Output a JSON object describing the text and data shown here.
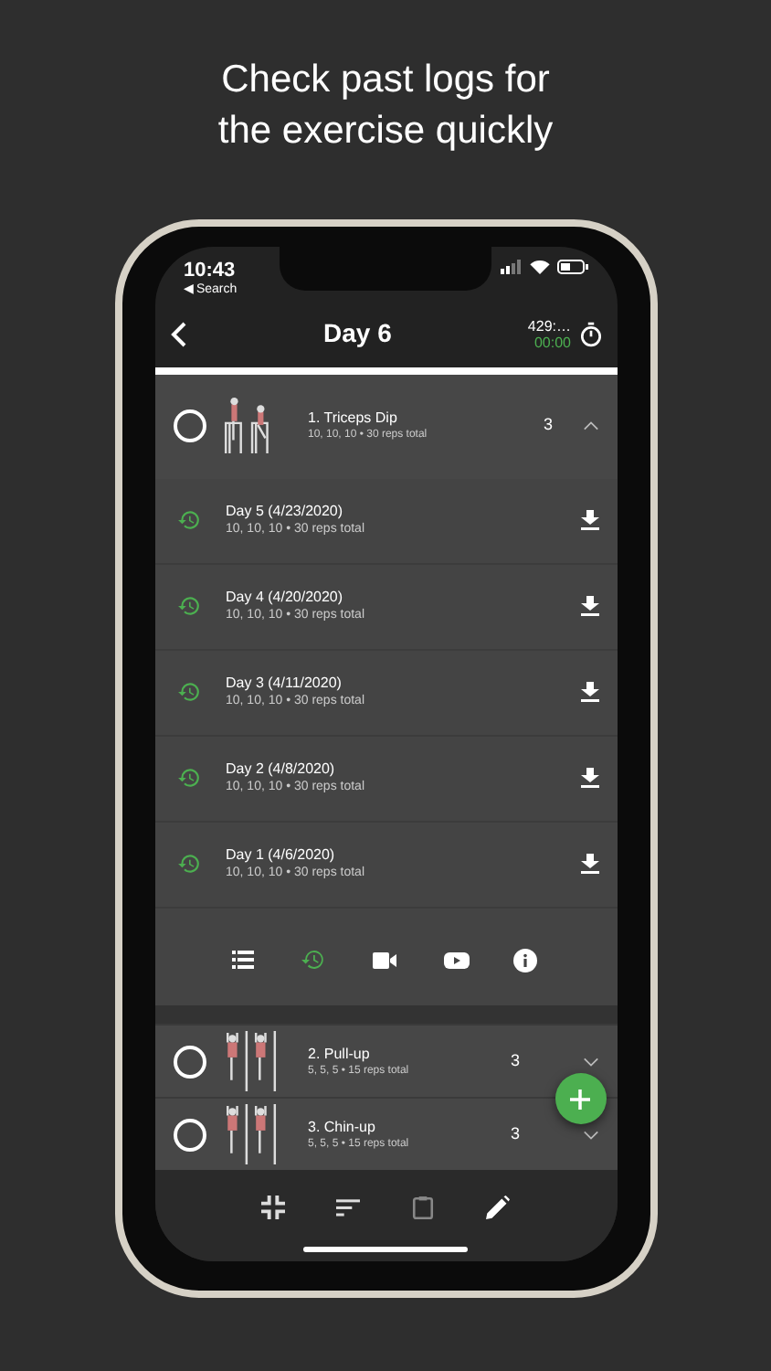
{
  "headline": [
    "Check past logs for",
    "the exercise quickly"
  ],
  "status_bar": {
    "time": "10:43",
    "back_app": "◀ Search"
  },
  "header": {
    "title": "Day 6",
    "timer_top": "429:…",
    "timer_bottom": "00:00"
  },
  "exercises": [
    {
      "name": "1. Triceps Dip",
      "summary": "10, 10, 10 • 30 reps total",
      "sets": "3",
      "expanded": true,
      "done": false,
      "history": [
        {
          "title": "Day 5 (4/23/2020)",
          "summary": "10, 10, 10 • 30 reps total"
        },
        {
          "title": "Day 4 (4/20/2020)",
          "summary": "10, 10, 10 • 30 reps total"
        },
        {
          "title": "Day 3 (4/11/2020)",
          "summary": "10, 10, 10 • 30 reps total"
        },
        {
          "title": "Day 2 (4/8/2020)",
          "summary": "10, 10, 10 • 30 reps total"
        },
        {
          "title": "Day 1 (4/6/2020)",
          "summary": "10, 10, 10 • 30 reps total"
        }
      ],
      "tools": [
        {
          "kind": "list",
          "selected": false
        },
        {
          "kind": "history",
          "selected": true
        },
        {
          "kind": "video",
          "selected": false
        },
        {
          "kind": "youtube",
          "selected": false
        },
        {
          "kind": "info",
          "selected": false
        }
      ]
    },
    {
      "name": "2. Pull-up",
      "summary": "5, 5, 5 • 15 reps total",
      "sets": "3",
      "expanded": false,
      "done": false
    },
    {
      "name": "3. Chin-up",
      "summary": "5, 5, 5 • 15 reps total",
      "sets": "3",
      "expanded": false,
      "done": false
    }
  ],
  "bottom_bar": [
    {
      "kind": "collapse"
    },
    {
      "kind": "sort"
    },
    {
      "kind": "clipboard"
    },
    {
      "kind": "edit"
    }
  ]
}
